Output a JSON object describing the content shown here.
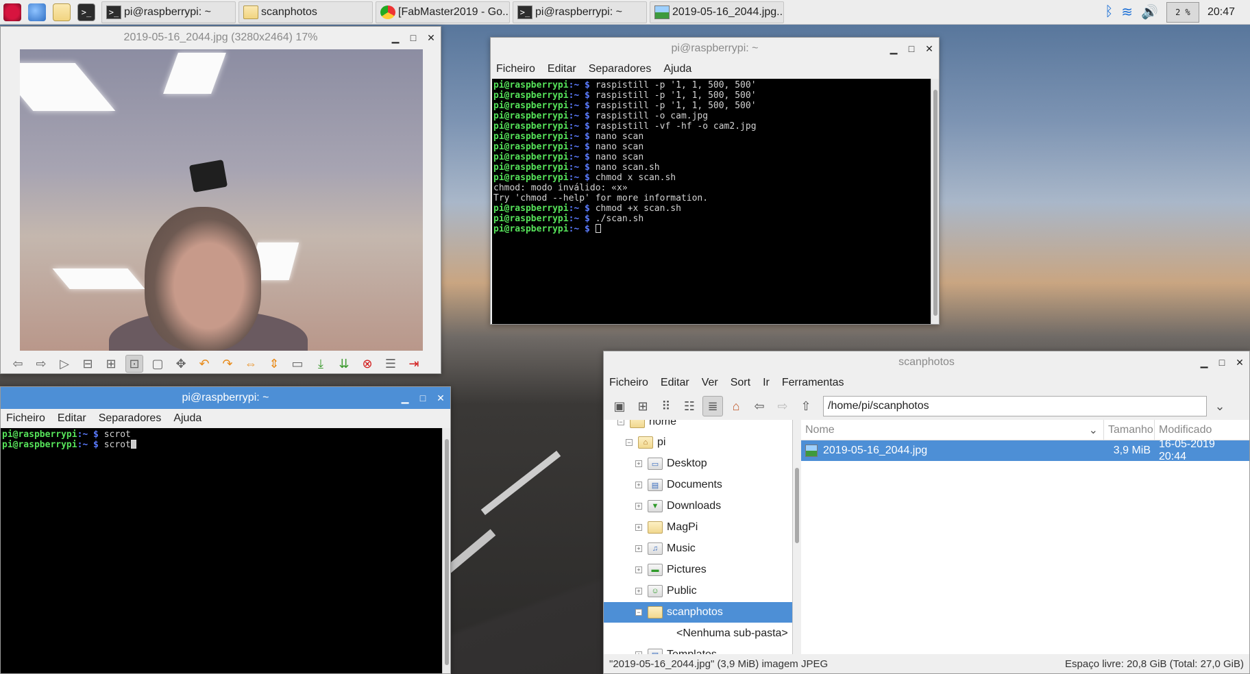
{
  "taskbar": {
    "tasks": [
      {
        "label": "pi@raspberrypi: ~"
      },
      {
        "label": "scanphotos"
      },
      {
        "label": "[FabMaster2019 - Go..."
      },
      {
        "label": "pi@raspberrypi: ~"
      },
      {
        "label": "2019-05-16_2044.jpg..."
      }
    ],
    "cpu": "2 %",
    "clock": "20:47"
  },
  "viewer": {
    "title": "2019-05-16_2044.jpg (3280x2464) 17%"
  },
  "term_top": {
    "title": "pi@raspberrypi: ~",
    "menu": [
      "Ficheiro",
      "Editar",
      "Separadores",
      "Ajuda"
    ],
    "prompt_user": "pi@raspberrypi",
    "prompt_path": ":~ $ ",
    "lines": [
      {
        "cmd": "raspistill -p '1, 1, 500, 500'"
      },
      {
        "cmd": "raspistill -p '1, 1, 500, 500'"
      },
      {
        "cmd": "raspistill -p '1, 1, 500, 500'"
      },
      {
        "cmd": "raspistill -o cam.jpg"
      },
      {
        "cmd": "raspistill -vf -hf -o cam2.jpg"
      },
      {
        "cmd": "nano scan"
      },
      {
        "cmd": "nano scan"
      },
      {
        "cmd": "nano scan"
      },
      {
        "cmd": "nano scan.sh"
      },
      {
        "cmd": "chmod x scan.sh"
      },
      {
        "out": "chmod: modo inválido: «x»"
      },
      {
        "out": "Try 'chmod --help' for more information."
      },
      {
        "cmd": "chmod +x scan.sh"
      },
      {
        "cmd": "./scan.sh"
      },
      {
        "cmd": ""
      }
    ]
  },
  "term_bottom": {
    "title": "pi@raspberrypi: ~",
    "menu": [
      "Ficheiro",
      "Editar",
      "Separadores",
      "Ajuda"
    ],
    "lines": [
      {
        "cmd": "scrot"
      },
      {
        "cmd": "scrot"
      }
    ]
  },
  "filemanager": {
    "title": "scanphotos",
    "menu": [
      "Ficheiro",
      "Editar",
      "Ver",
      "Sort",
      "Ir",
      "Ferramentas"
    ],
    "path": "/home/pi/scanphotos",
    "tree": [
      {
        "label": "home"
      },
      {
        "label": "pi"
      },
      {
        "label": "Desktop"
      },
      {
        "label": "Documents"
      },
      {
        "label": "Downloads"
      },
      {
        "label": "MagPi"
      },
      {
        "label": "Music"
      },
      {
        "label": "Pictures"
      },
      {
        "label": "Public"
      },
      {
        "label": "scanphotos"
      },
      {
        "label": "<Nenhuma sub-pasta>"
      },
      {
        "label": "Templates"
      }
    ],
    "columns": [
      "Nome",
      "Tamanho",
      "Modificado"
    ],
    "files": [
      {
        "name": "2019-05-16_2044.jpg",
        "size": "3,9 MiB",
        "modified": "16-05-2019 20:44"
      }
    ],
    "status_left": "\"2019-05-16_2044.jpg\" (3,9 MiB) imagem JPEG",
    "status_right": "Espaço livre: 20,8 GiB (Total: 27,0 GiB)"
  },
  "icons": {
    "accent": "#4d8fd6",
    "prompt_green": "#56e35a",
    "prompt_blue": "#5b7cff"
  }
}
